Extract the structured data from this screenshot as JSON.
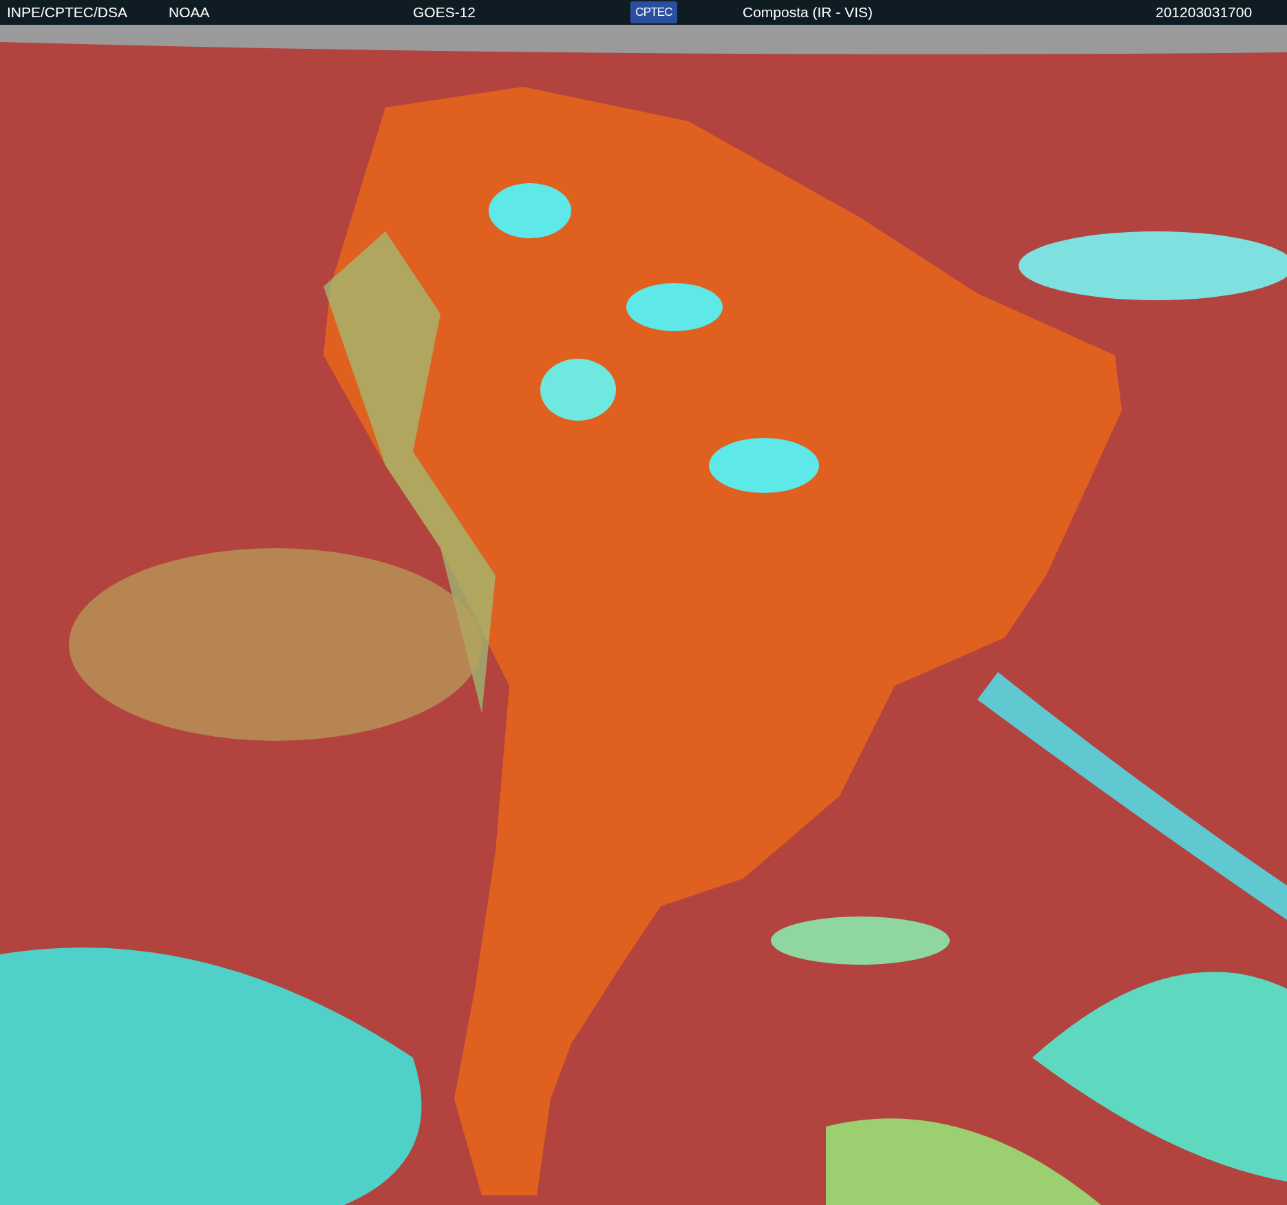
{
  "header": {
    "source": "INPE/CPTEC/DSA",
    "agency": "NOAA",
    "satellite": "GOES-12",
    "logo_text": "CPTEC",
    "product": "Composta (IR - VIS)",
    "timestamp": "201203031700"
  }
}
